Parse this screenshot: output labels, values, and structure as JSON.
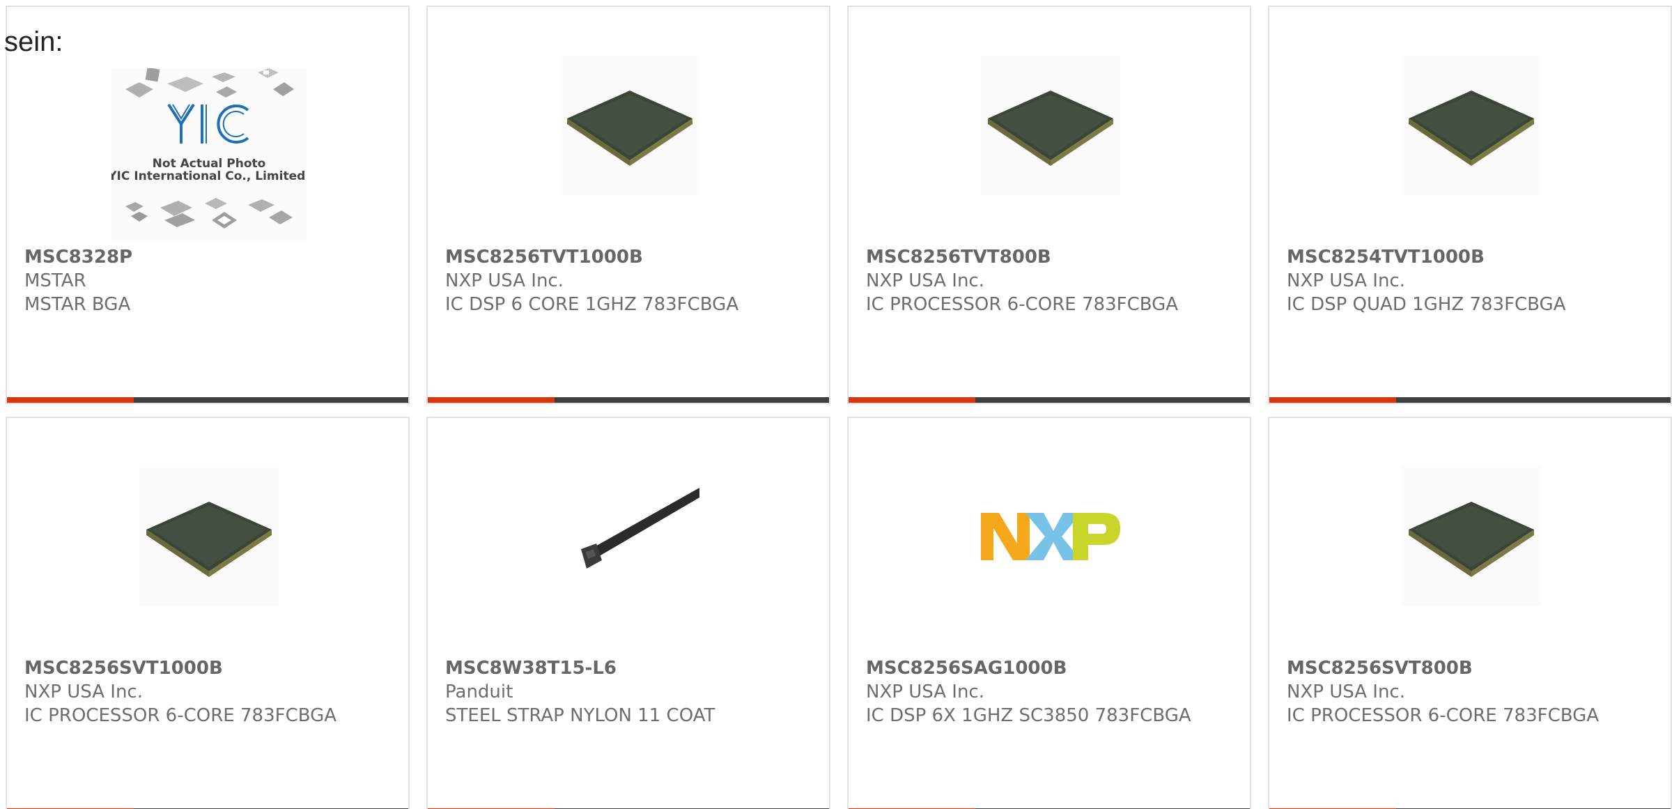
{
  "lead_text": "sein:",
  "colors": {
    "accent": "#d8360f",
    "bar": "#3f3f3f",
    "nxp_orange": "#f5a81c",
    "nxp_blue": "#78c2e8",
    "nxp_green": "#c9d52b"
  },
  "placeholder_image": {
    "caption_line1": "Not Actual Photo",
    "caption_line2": "YIC International Co., Limited.",
    "logo_text": "YIC"
  },
  "nxp_logo_text": "NXP",
  "products": [
    {
      "part": "MSC8328P",
      "maker": "MSTAR",
      "desc": "MSTAR BGA",
      "image": "yic-placeholder"
    },
    {
      "part": "MSC8256TVT1000B",
      "maker": "NXP USA Inc.",
      "desc": "IC DSP 6 CORE 1GHZ 783FCBGA",
      "image": "bga-chip"
    },
    {
      "part": "MSC8256TVT800B",
      "maker": "NXP USA Inc.",
      "desc": "IC PROCESSOR 6-CORE 783FCBGA",
      "image": "bga-chip"
    },
    {
      "part": "MSC8254TVT1000B",
      "maker": "NXP USA Inc.",
      "desc": "IC DSP QUAD 1GHZ 783FCBGA",
      "image": "bga-chip"
    },
    {
      "part": "MSC8256SVT1000B",
      "maker": "NXP USA Inc.",
      "desc": "IC PROCESSOR 6-CORE 783FCBGA",
      "image": "bga-chip"
    },
    {
      "part": "MSC8W38T15-L6",
      "maker": "Panduit",
      "desc": "STEEL STRAP NYLON 11 COAT",
      "image": "steel-strap"
    },
    {
      "part": "MSC8256SAG1000B",
      "maker": "NXP USA Inc.",
      "desc": "IC DSP 6X 1GHZ SC3850 783FCBGA",
      "image": "nxp-logo"
    },
    {
      "part": "MSC8256SVT800B",
      "maker": "NXP USA Inc.",
      "desc": "IC PROCESSOR 6-CORE 783FCBGA",
      "image": "bga-chip"
    }
  ]
}
